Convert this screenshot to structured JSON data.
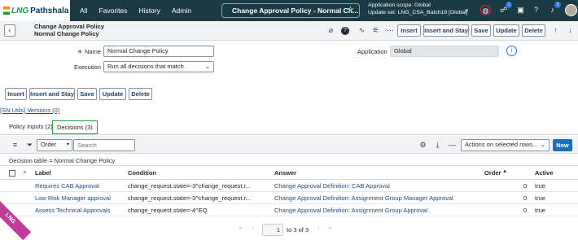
{
  "nav": {
    "logo_prefix": "LNG",
    "logo_text": "Pathshala",
    "links": [
      "All",
      "Favorites",
      "History",
      "Admin"
    ],
    "record_title": "Change Approval Policy - Normal Ch...",
    "scope_line1": "Application scope: Global",
    "scope_line2": "Update set: LNG_CSA_Batch18 [Global]",
    "badge_count_1": "1",
    "badge_count_2": "3"
  },
  "form_header": {
    "title_line1": "Change Approval Policy",
    "title_line2": "Normal Change Policy",
    "buttons": [
      "Insert",
      "Insert and Stay",
      "Save",
      "Update",
      "Delete"
    ]
  },
  "form": {
    "name_label": "Name",
    "name_value": "Normal Change Policy",
    "execution_label": "Execution",
    "execution_value": "Run all decisions that match",
    "application_label": "Application",
    "application_value": "Global"
  },
  "bottom_buttons": [
    "Insert",
    "Insert and Stay",
    "Save",
    "Update",
    "Delete"
  ],
  "versions_link": "[SN Utils] Versions (0)",
  "tabs": [
    "Policy Inputs (2)",
    "Decisions (3)"
  ],
  "list": {
    "filter_field": "Order",
    "search_placeholder": "Search",
    "actions_select": "Actions on selected rows...",
    "new_button": "New",
    "breadcrumb": "Decision table = Normal Change Policy",
    "columns": [
      "Label",
      "Condition",
      "Answer",
      "Order",
      "Active"
    ],
    "rows": [
      {
        "label": "Requires CAB Approval",
        "condition": "change_request.state=-3^change_request.r...",
        "answer": "Change Approval Definition: CAB Approval",
        "order": "0",
        "active": "true"
      },
      {
        "label": "Low Risk Manager approval",
        "condition": "change_request.state=-3^change_request.r...",
        "answer": "Change Approval Definition: Assignment Group Manager Approval",
        "order": "0",
        "active": "true"
      },
      {
        "label": "Assess Technical Approvals",
        "condition": "change_request.state=-4^EQ",
        "answer": "Change Approval Definition: Assignment Group Approval",
        "order": "0",
        "active": "true"
      }
    ],
    "pager_current": "1",
    "pager_text": "to 3 of 3"
  },
  "corner_text": "LNG"
}
